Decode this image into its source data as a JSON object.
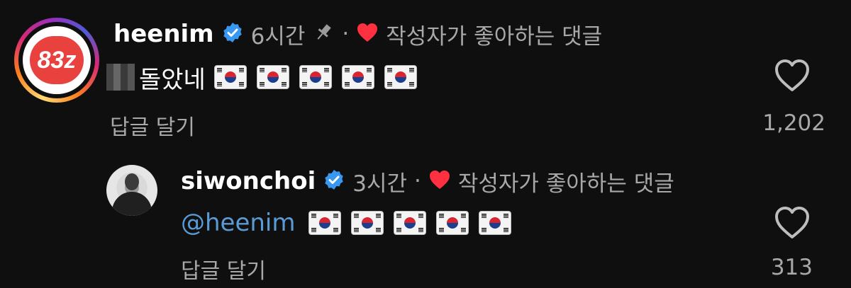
{
  "comments": [
    {
      "username": "heenim",
      "verified": true,
      "time": "6시간",
      "pinned": true,
      "separator": "·",
      "liked_by_creator": "작성자가 좋아하는 댓글",
      "text": "돌았네",
      "flags_count": 5,
      "reply_label": "답글 달기",
      "like_count": "1,202",
      "avatar_logo_text": "83z"
    },
    {
      "username": "siwonchoi",
      "verified": true,
      "time": "3시간",
      "separator": "·",
      "liked_by_creator": "작성자가 좋아하는 댓글",
      "mention": "@heenim",
      "flags_count": 5,
      "reply_label": "답글 달기",
      "like_count": "313"
    }
  ],
  "colors": {
    "background": "#0f0f0f",
    "verified": "#3897f0",
    "heart_red": "#ff3040",
    "mention": "#5b9bd5",
    "secondary_text": "#a8a8a8"
  }
}
